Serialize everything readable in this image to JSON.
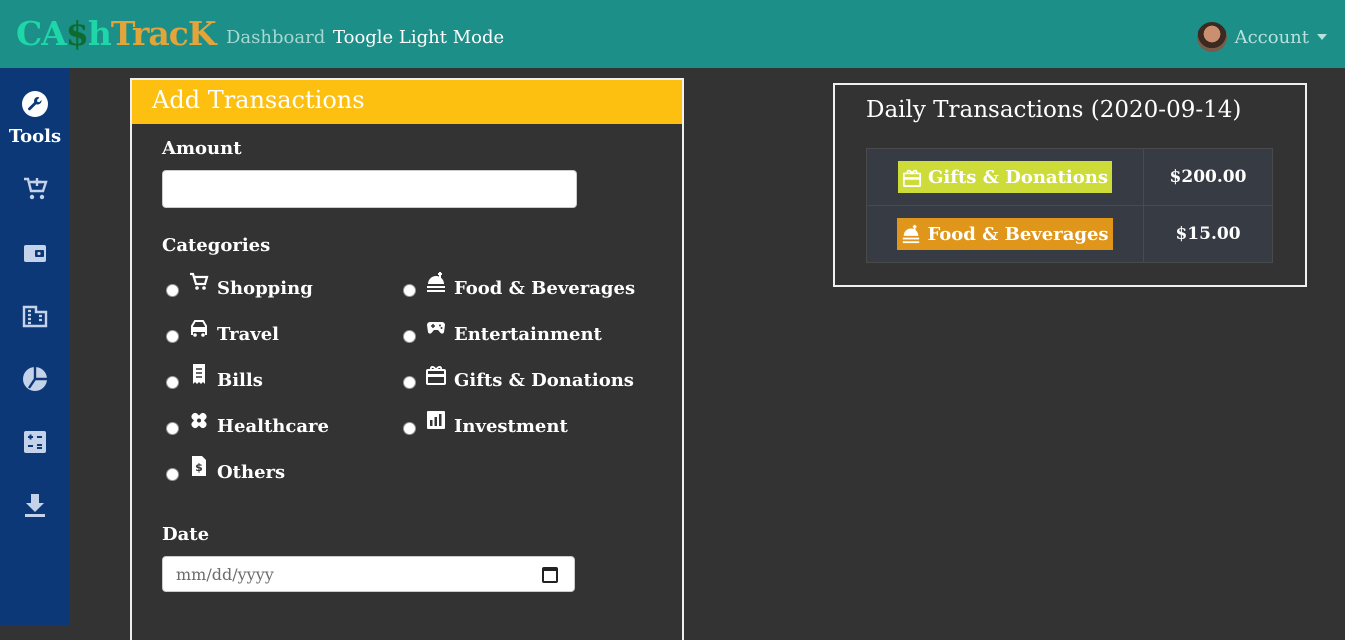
{
  "navbar": {
    "brand": {
      "part1": "CA",
      "part2": "$",
      "part3": "h",
      "part4": "TracK"
    },
    "links": {
      "dashboard": "Dashboard",
      "toggle": "Toogle Light Mode"
    },
    "account": "Account"
  },
  "sidebar": {
    "tools_label": "Tools",
    "icons": [
      "add-cart-icon",
      "wallet-icon",
      "building-icon",
      "pie-chart-icon",
      "calculator-icon",
      "download-icon"
    ]
  },
  "add_card": {
    "title": "Add Transactions",
    "amount_label": "Amount",
    "amount_value": "",
    "categories_label": "Categories",
    "categories": [
      {
        "label": "Shopping",
        "icon": "cart-icon"
      },
      {
        "label": "Food & Beverages",
        "icon": "food-icon"
      },
      {
        "label": "Travel",
        "icon": "travel-icon"
      },
      {
        "label": "Entertainment",
        "icon": "gamepad-icon"
      },
      {
        "label": "Bills",
        "icon": "receipt-icon"
      },
      {
        "label": "Gifts & Donations",
        "icon": "gift-icon"
      },
      {
        "label": "Healthcare",
        "icon": "bandage-icon"
      },
      {
        "label": "Investment",
        "icon": "investment-icon"
      },
      {
        "label": "Others",
        "icon": "dollar-file-icon"
      }
    ],
    "date_label": "Date",
    "date_placeholder": "mm/dd/yyyy"
  },
  "daily_card": {
    "title": "Daily Transactions (2020-09-14)",
    "rows": [
      {
        "category": "Gifts & Donations",
        "amount": "$200.00",
        "color": "#cddc39"
      },
      {
        "category": "Food & Beverages",
        "amount": "$15.00",
        "color": "#e0961b"
      }
    ]
  },
  "colors": {
    "navbar": "#1b8f88",
    "sidebar": "#0c3878",
    "background": "#333333",
    "card_header": "#fdc010"
  }
}
